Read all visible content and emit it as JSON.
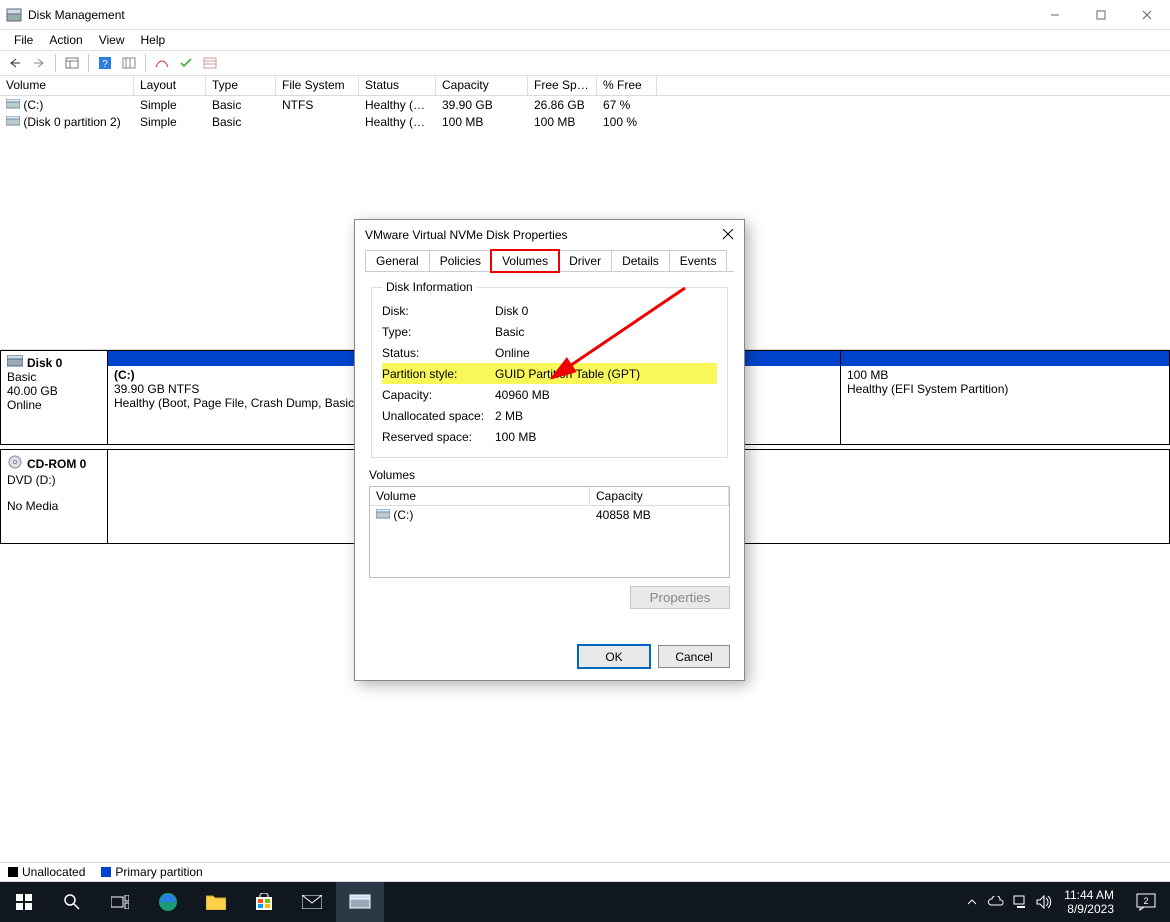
{
  "window": {
    "title": "Disk Management"
  },
  "menu": {
    "file": "File",
    "action": "Action",
    "view": "View",
    "help": "Help"
  },
  "volumeColumns": {
    "volume": "Volume",
    "layout": "Layout",
    "type": "Type",
    "fs": "File System",
    "status": "Status",
    "capacity": "Capacity",
    "free": "Free Spa...",
    "pct": "% Free"
  },
  "volumes": [
    {
      "name": "(C:)",
      "layout": "Simple",
      "type": "Basic",
      "fs": "NTFS",
      "status": "Healthy (B...",
      "capacity": "39.90 GB",
      "free": "26.86 GB",
      "pct": "67 %"
    },
    {
      "name": "(Disk 0 partition 2)",
      "layout": "Simple",
      "type": "Basic",
      "fs": "",
      "status": "Healthy (E...",
      "capacity": "100 MB",
      "free": "100 MB",
      "pct": "100 %"
    }
  ],
  "disks": [
    {
      "name": "Disk 0",
      "type": "Basic",
      "size": "40.00 GB",
      "status": "Online",
      "partitions": [
        {
          "title": "(C:)",
          "detail": "39.90 GB NTFS",
          "health": "Healthy (Boot, Page File, Crash Dump, Basic"
        },
        {
          "title": "",
          "detail": "100 MB",
          "health": "Healthy (EFI System Partition)"
        }
      ]
    },
    {
      "name": "CD-ROM 0",
      "type": "DVD (D:)",
      "size": "",
      "status": "No Media",
      "partitions": []
    }
  ],
  "legend": {
    "unallocated": "Unallocated",
    "primary": "Primary partition"
  },
  "dialog": {
    "title": "VMware Virtual NVMe Disk Properties",
    "tabs": {
      "general": "General",
      "policies": "Policies",
      "volumes": "Volumes",
      "driver": "Driver",
      "details": "Details",
      "events": "Events"
    },
    "activeTab": "volumes",
    "fieldset": "Disk Information",
    "info": {
      "disk_k": "Disk:",
      "disk_v": "Disk 0",
      "type_k": "Type:",
      "type_v": "Basic",
      "status_k": "Status:",
      "status_v": "Online",
      "pstyle_k": "Partition style:",
      "pstyle_v": "GUID Partition Table (GPT)",
      "cap_k": "Capacity:",
      "cap_v": "40960 MB",
      "unalloc_k": "Unallocated space:",
      "unalloc_v": "2 MB",
      "reserved_k": "Reserved space:",
      "reserved_v": "100 MB"
    },
    "volumesLabel": "Volumes",
    "volTable": {
      "head_vol": "Volume",
      "head_cap": "Capacity",
      "rows": [
        {
          "name": "(C:)",
          "cap": "40858 MB"
        }
      ]
    },
    "propertiesBtn": "Properties",
    "ok": "OK",
    "cancel": "Cancel"
  },
  "taskbar": {
    "time": "11:44 AM",
    "date": "8/9/2023",
    "notif": "2"
  }
}
